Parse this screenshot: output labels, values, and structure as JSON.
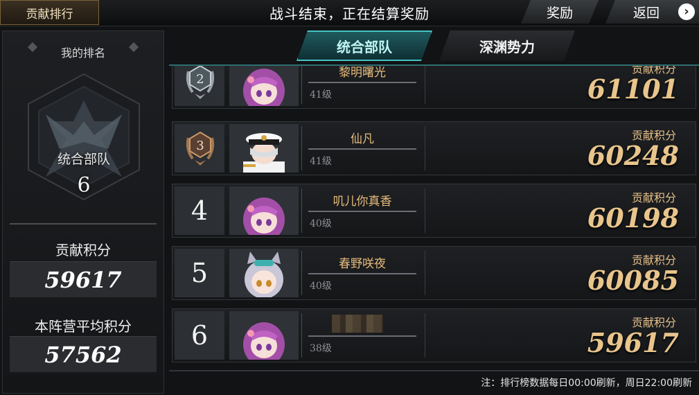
{
  "header": {
    "title_tab": "贡献排行",
    "status": "战斗结束，正在结算奖励",
    "reward_button": "奖励",
    "back_button": "返回"
  },
  "left_panel": {
    "my_rank_label": "我的排名",
    "team_name": "统合部队",
    "rank": "6",
    "contribution_label": "贡献积分",
    "contribution_value": "59617",
    "avg_label": "本阵营平均积分",
    "avg_value": "57562"
  },
  "tabs": [
    {
      "label": "统合部队",
      "active": true
    },
    {
      "label": "深渊势力",
      "active": false
    }
  ],
  "score_label": "贡献积分",
  "rows": [
    {
      "rank": "2",
      "name": "黎明曙光",
      "level": "41级",
      "score": "61101",
      "avatar": "pink-hair-girl"
    },
    {
      "rank": "3",
      "name": "仙凡",
      "level": "41级",
      "score": "60248",
      "avatar": "captain-white-hair"
    },
    {
      "rank": "4",
      "name": "叽儿你真香",
      "level": "40级",
      "score": "60198",
      "avatar": "pink-hair-girl"
    },
    {
      "rank": "5",
      "name": "春野咲夜",
      "level": "40级",
      "score": "60085",
      "avatar": "silver-hair-cat-ears"
    },
    {
      "rank": "6",
      "name": "",
      "level": "38级",
      "score": "59617",
      "avatar": "pink-hair-girl"
    }
  ],
  "footer_note": "注：排行榜数据每日00:00刷新，周日22:00刷新",
  "colors": {
    "accent_teal": "#48c4c4",
    "gold": "#e9c58c",
    "pink_hair": "#b45ab8"
  }
}
